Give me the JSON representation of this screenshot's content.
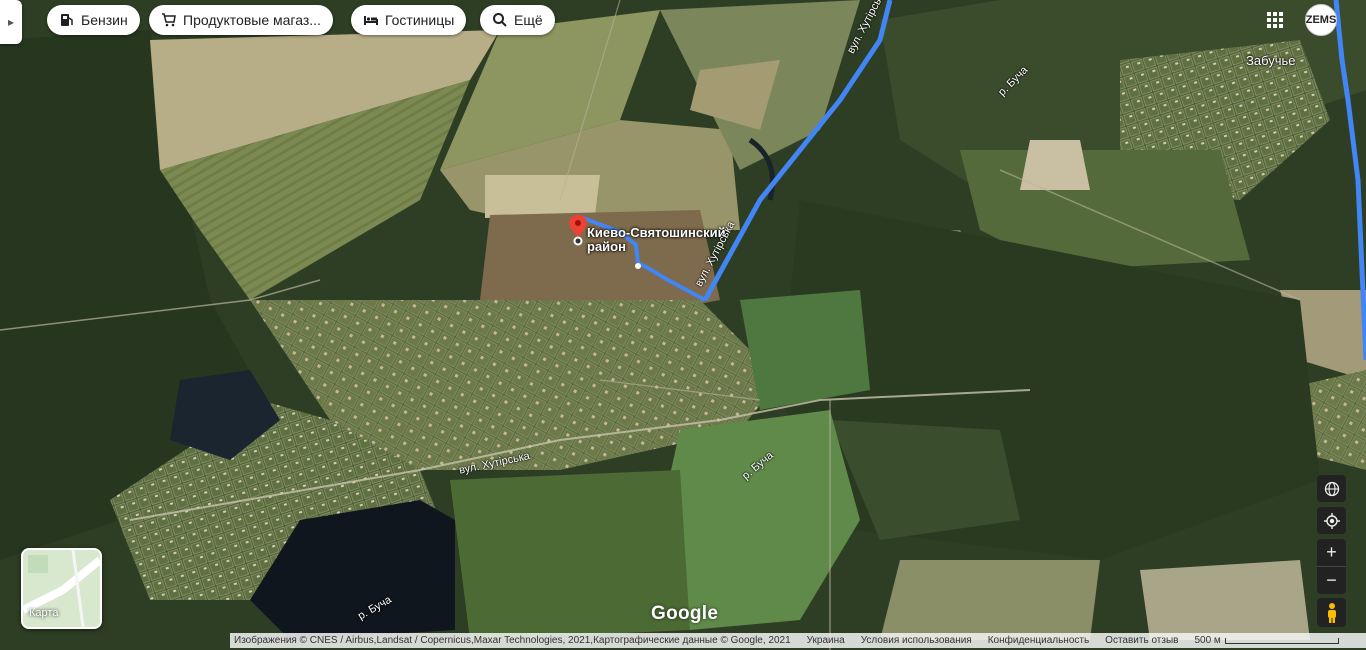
{
  "toolbar": {
    "chips": [
      {
        "label": "Бензин",
        "icon": "gas-station-icon"
      },
      {
        "label": "Продуктовые магаз...",
        "icon": "shopping-cart-icon"
      },
      {
        "label": "Гостиницы",
        "icon": "hotel-bed-icon"
      },
      {
        "label": "Ещё",
        "icon": "search-icon"
      }
    ],
    "collapse_icon": "chevron-right-icon"
  },
  "account": {
    "avatar_text": "ZEMS",
    "apps_icon": "apps-grid-icon"
  },
  "map": {
    "type": "satellite",
    "place_label": {
      "line1": "Киево-Святошинский",
      "line2": "район"
    },
    "route_color": "#4285f4",
    "street_labels": [
      "вул. Хутірська",
      "вул. Хутірська",
      "вул. Хутірська"
    ],
    "river_labels": [
      "р. Буча",
      "р. Буча",
      "р. Буча"
    ],
    "village_label": "Забучье"
  },
  "controls": {
    "globe_icon": "globe-icon",
    "my_location_icon": "my-location-icon",
    "zoom_in": "+",
    "zoom_out": "−",
    "pegman_icon": "pegman-icon"
  },
  "layer_switch": {
    "label": "Карта"
  },
  "logo": "Google",
  "footer": {
    "attribution": "Изображения © CNES / Airbus,Landsat / Copernicus,Maxar Technologies, 2021,Картографические данные © Google, 2021",
    "country": "Украина",
    "terms": "Условия использования",
    "privacy": "Конфиденциальность",
    "feedback": "Оставить отзыв",
    "scale": "500 м"
  }
}
